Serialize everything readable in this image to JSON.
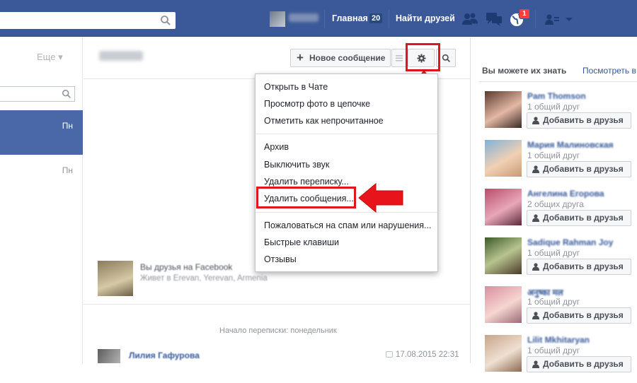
{
  "topbar": {
    "nav_home": "Главная",
    "nav_home_count": "20",
    "nav_find_friends": "Найти друзей",
    "notifications_badge": "1"
  },
  "left_panel": {
    "more_label": "Еще ▾",
    "threads": [
      {
        "day": "Пн",
        "selected": true
      },
      {
        "day": "Пн",
        "selected": false
      }
    ]
  },
  "toolbar": {
    "new_message_label": "Новое сообщение"
  },
  "settings_menu": {
    "items": [
      "Открыть в Чате",
      "Просмотр фото в цепочке",
      "Отметить как непрочитанное",
      "Архив",
      "Выключить звук",
      "Удалить переписку...",
      "Удалить сообщения...",
      "Пожаловаться на спам или нарушения...",
      "Быстрые клавиши",
      "Отзывы"
    ]
  },
  "conversation": {
    "friend_status": "Вы друзья на Facebook",
    "friend_location": "Живет в Erevan, Yerevan, Armenia",
    "start_label": "Начало переписки: понедельник",
    "message_author": "Лилия Гафурова",
    "message_time": "17.08.2015 22:31"
  },
  "people_you_may_know": {
    "title": "Вы можете их знать",
    "see_all_label": "Посмотреть в",
    "add_friend_label": "Добавить в друзья",
    "people": [
      {
        "name": "Pam Thomson",
        "mutual": "1 общий друг"
      },
      {
        "name": "Мария Малиновская",
        "mutual": "1 общий друг"
      },
      {
        "name": "Ангелина Егорова",
        "mutual": "2 общих друга"
      },
      {
        "name": "Sadique Rahman Joy",
        "mutual": "1 общий друг"
      },
      {
        "name": "अनुष्का मल",
        "mutual": "1 общий друг"
      },
      {
        "name": "Lilit Mkhitaryan",
        "mutual": "1 общий друг"
      }
    ]
  },
  "colors": {
    "brand_blue": "#3b5998",
    "selected_thread": "#4a68a7",
    "highlight_red": "#e0151d",
    "link_blue": "#365899"
  }
}
